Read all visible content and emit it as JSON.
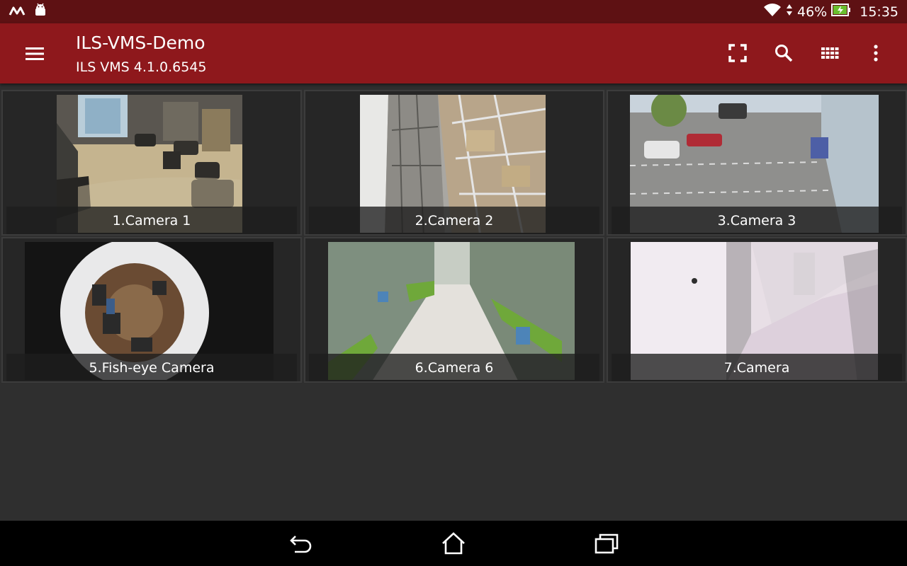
{
  "status_bar": {
    "battery": "46%",
    "time": "15:35"
  },
  "app_bar": {
    "title": "ILS-VMS-Demo",
    "subtitle": "ILS VMS 4.1.0.6545"
  },
  "cameras": [
    {
      "label": "1.Camera 1"
    },
    {
      "label": "2.Camera 2"
    },
    {
      "label": "3.Camera 3"
    },
    {
      "label": "5.Fish-eye Camera"
    },
    {
      "label": "6.Camera 6"
    },
    {
      "label": "7.Camera"
    }
  ],
  "colors": {
    "status_bar": "#5e1113",
    "app_bar": "#8e181c",
    "background": "#2f2f2f",
    "battery_charging": "#6abf2e"
  },
  "icons": {
    "status_left": [
      "app-m-icon",
      "android-icon"
    ],
    "status_right": [
      "wifi-icon",
      "data-arrows-icon",
      "battery-charging-icon"
    ],
    "app_actions": [
      "fullscreen-icon",
      "search-icon",
      "grid-layout-icon",
      "more-vert-icon"
    ],
    "nav": [
      "back-icon",
      "home-icon",
      "recents-icon"
    ]
  }
}
